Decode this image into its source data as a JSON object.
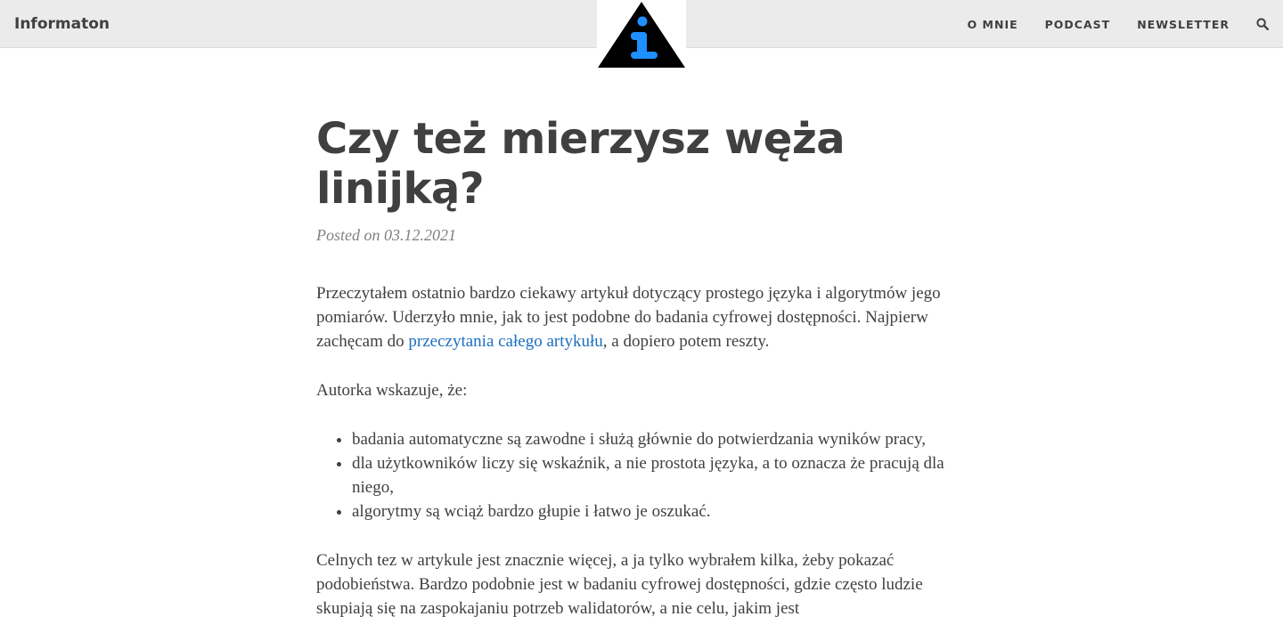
{
  "header": {
    "brand": "Informaton",
    "logo_alt": "i",
    "nav": [
      {
        "label": "O MNIE"
      },
      {
        "label": "PODCAST"
      },
      {
        "label": "NEWSLETTER"
      }
    ],
    "search_icon": "search-icon"
  },
  "post": {
    "title": "Czy też mierzysz węża linijką?",
    "meta": "Posted on 03.12.2021",
    "p1_before": "Przeczytałem ostatnio bardzo ciekawy artykuł dotyczący prostego języka i algorytmów jego pomiarów. Uderzyło mnie, jak to jest podobne do badania cyfrowej dostępności. Najpierw zachęcam do ",
    "p1_link": "przeczytania całego artykułu",
    "p1_after": ", a dopiero potem reszty.",
    "p2": "Autorka wskazuje, że:",
    "bullets": [
      "badania automatyczne są zawodne i służą głównie do potwierdzania wyników pracy,",
      "dla użytkowników liczy się wskaźnik, a nie prostota języka, a to oznacza że pracują dla niego,",
      "algorytmy są wciąż bardzo głupie i łatwo je oszukać."
    ],
    "p3": "Celnych tez w artykule jest znacznie więcej, a ja tylko wybrałem kilka, żeby pokazać podobieństwa. Bardzo podobnie jest w badaniu cyfrowej dostępności, gdzie często ludzie skupiają się na zaspokajaniu potrzeb walidatorów, a nie celu, jakim jest"
  },
  "colors": {
    "navbar_bg": "#ebebeb",
    "text": "#404040",
    "meta": "#808080",
    "link": "#1a6fbf",
    "logo_triangle": "#000000",
    "logo_i": "#1e90ff"
  }
}
